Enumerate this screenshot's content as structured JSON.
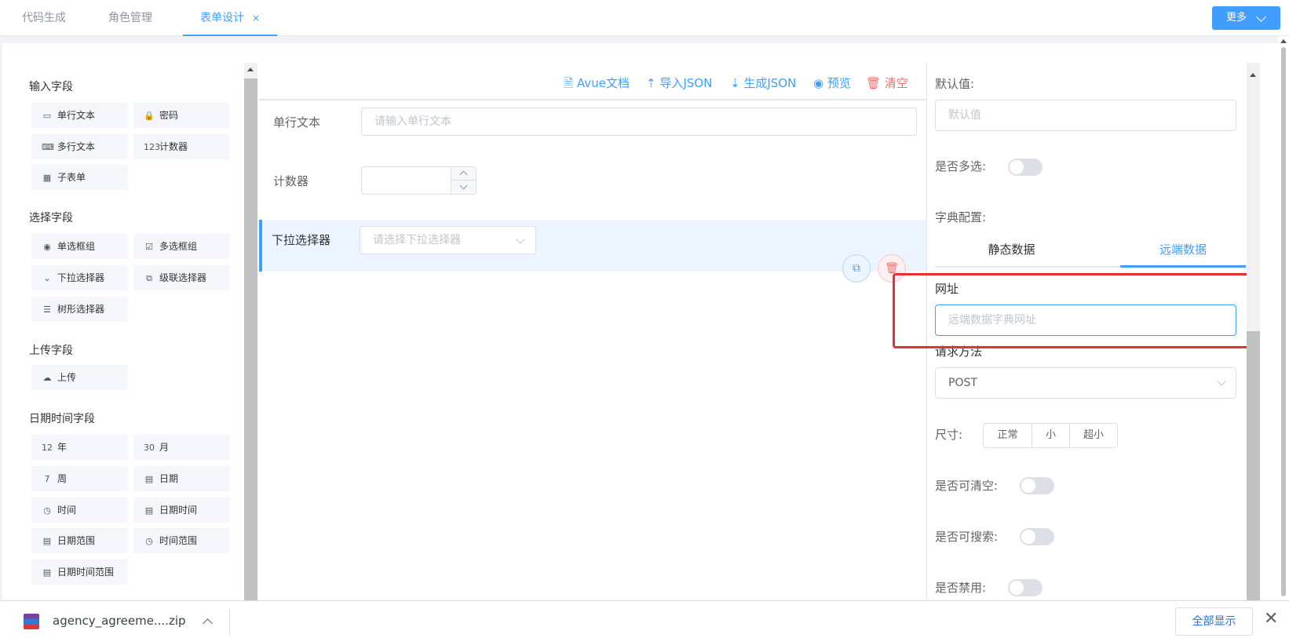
{
  "tabs": [
    {
      "label": "代码生成"
    },
    {
      "label": "角色管理"
    },
    {
      "label": "表单设计",
      "close": "×"
    }
  ],
  "more_button": {
    "label": "更多"
  },
  "left_panel": {
    "groups": [
      {
        "title": "输入字段",
        "items": [
          {
            "label": "单行文本",
            "icon": "▭"
          },
          {
            "label": "密码",
            "icon": "🔒"
          },
          {
            "label": "多行文本",
            "icon": "⌨"
          },
          {
            "label": "计数器",
            "icon": "123"
          },
          {
            "label": "子表单",
            "icon": "▦"
          }
        ]
      },
      {
        "title": "选择字段",
        "items": [
          {
            "label": "单选框组",
            "icon": "◉"
          },
          {
            "label": "多选框组",
            "icon": "☑"
          },
          {
            "label": "下拉选择器",
            "icon": "⌄"
          },
          {
            "label": "级联选择器",
            "icon": "⧉"
          },
          {
            "label": "树形选择器",
            "icon": "☰"
          }
        ]
      },
      {
        "title": "上传字段",
        "items": [
          {
            "label": "上传",
            "icon": "☁"
          }
        ]
      },
      {
        "title": "日期时间字段",
        "items": [
          {
            "label": "年",
            "icon": "12"
          },
          {
            "label": "月",
            "icon": "30"
          },
          {
            "label": "周",
            "icon": "7"
          },
          {
            "label": "日期",
            "icon": "▤"
          },
          {
            "label": "时间",
            "icon": "◷"
          },
          {
            "label": "日期时间",
            "icon": "▤"
          },
          {
            "label": "日期范围",
            "icon": "▤"
          },
          {
            "label": "时间范围",
            "icon": "◷"
          },
          {
            "label": "日期时间范围",
            "icon": "▤"
          }
        ]
      }
    ]
  },
  "toolbar": {
    "doc": "Avue文档",
    "import": "导入JSON",
    "generate": "生成JSON",
    "preview": "预览",
    "clear": "清空",
    "doc_icon": "🗎",
    "import_icon": "⇡",
    "generate_icon": "⇣",
    "preview_icon": "◉",
    "clear_icon": "🗑"
  },
  "canvas": {
    "text_field": {
      "label": "单行文本",
      "placeholder": "请输入单行文本"
    },
    "counter": {
      "label": "计数器"
    },
    "select_field": {
      "label": "下拉选择器",
      "placeholder": "请选择下拉选择器"
    },
    "copy_icon": "⧉",
    "delete_icon": "🗑"
  },
  "properties": {
    "default_value": {
      "label": "默认值:",
      "placeholder": "默认值"
    },
    "multiple": {
      "label": "是否多选:"
    },
    "dict_config": {
      "label": "字典配置:"
    },
    "dict_tabs": [
      {
        "label": "静态数据"
      },
      {
        "label": "远端数据"
      }
    ],
    "url": {
      "label": "网址",
      "placeholder": "远端数据字典网址"
    },
    "method": {
      "label": "请求方法",
      "value": "POST"
    },
    "size": {
      "label": "尺寸:",
      "options": [
        "正常",
        "小",
        "超小"
      ]
    },
    "clearable": {
      "label": "是否可清空:"
    },
    "searchable": {
      "label": "是否可搜索:"
    },
    "disabled": {
      "label": "是否禁用:"
    }
  },
  "download_bar": {
    "file_name": "agency_agreeme....zip",
    "show_all": "全部显示",
    "close": "✕"
  },
  "colors": {
    "primary": "#409eff",
    "danger": "#f56c6c",
    "highlight": "#e6312e"
  }
}
